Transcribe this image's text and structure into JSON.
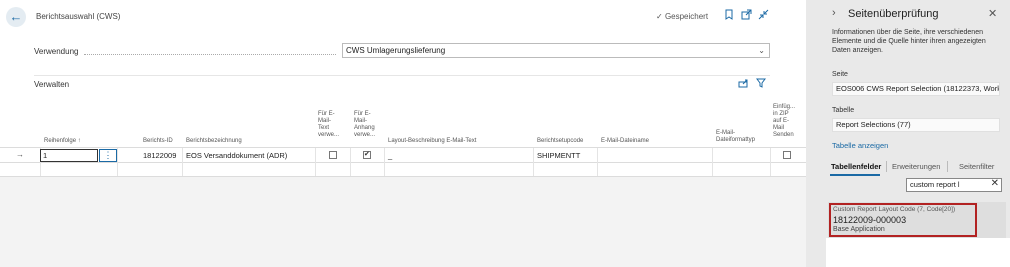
{
  "header": {
    "title": "Berichtsauswahl (CWS)",
    "saved_label": "Gespeichert"
  },
  "usage": {
    "label": "Verwendung",
    "value": "CWS Umlagerungslieferung"
  },
  "section": {
    "title": "Verwalten"
  },
  "columns": {
    "sequence": "Reihenfolge ↑",
    "report_id": "Berichts-ID",
    "report_name": "Berichtsbezeichnung",
    "email_body_use": [
      "Für E-",
      "Mail-",
      "Text",
      "verwe..."
    ],
    "email_attach_use": [
      "Für E-",
      "Mail-",
      "Anhang",
      "verwe..."
    ],
    "layout_desc": "Layout-Beschreibung E-Mail-Text",
    "setup_code": "Berichtsetupcode",
    "email_filename": "E-Mail-Dateiname",
    "email_fileformat": [
      "E-Mail-",
      "Dateiformattyp"
    ],
    "zip_send": [
      "Einfüg...",
      "in ZIP",
      "auf E-",
      "Mail",
      "Senden"
    ]
  },
  "rows": [
    {
      "sequence": "1",
      "report_id": "18122009",
      "report_name": "EOS Versanddokument (ADR)",
      "email_body_use": false,
      "email_attach_use": true,
      "layout_desc": "_",
      "setup_code": "SHIPMENTT",
      "email_filename": "",
      "email_fileformat": "",
      "zip_send": false
    }
  ],
  "panel": {
    "title": "Seitenüberprüfung",
    "description": "Informationen über die Seite, ihre verschiedenen Elemente und die Quelle hinter ihren angezeigten Daten anzeigen.",
    "page_label": "Seite",
    "page_value": "EOS006 CWS Report Selection (18122373, Works...",
    "table_label": "Tabelle",
    "table_value": "Report Selections (77)",
    "show_table_link": "Tabelle anzeigen",
    "tabs": [
      "Tabellenfelder",
      "Erweiterungen",
      "Seitenfilter"
    ],
    "search_value": "custom report l",
    "result": {
      "field": "Custom Report Layout Code (7, Code[20])",
      "value": "18122009-000003",
      "source": "Base Application"
    }
  }
}
